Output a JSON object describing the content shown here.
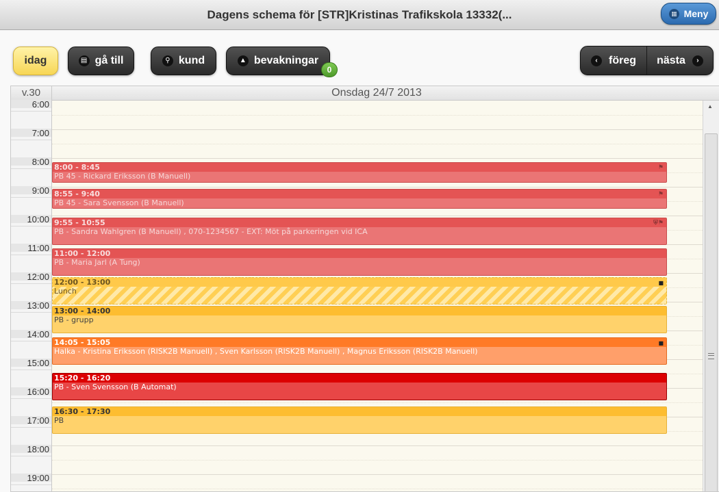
{
  "header": {
    "title": "Dagens schema för [STR]Kristinas Trafikskola 13332(...",
    "menu_label": "Meny"
  },
  "toolbar": {
    "today_label": "idag",
    "goto_label": "gå till",
    "customer_label": "kund",
    "watch_label": "bevakningar",
    "watch_count": "0",
    "prev_label": "föreg",
    "next_label": "nästa"
  },
  "calendar": {
    "week_label": "v.30",
    "day_title": "Onsdag 24/7 2013",
    "hours": [
      "6:00",
      "7:00",
      "8:00",
      "9:00",
      "10:00",
      "11:00",
      "12:00",
      "13:00",
      "14:00",
      "15:00",
      "16:00",
      "17:00",
      "18:00",
      "19:00"
    ],
    "events": [
      {
        "time": "8:00 - 8:45",
        "desc": "PB 45 - Rickard Eriksson (B Manuell)",
        "style": "red",
        "icon": "flag-icon"
      },
      {
        "time": "8:55 - 9:40",
        "desc": "PB 45 - Sara Svensson (B Manuell)",
        "style": "red",
        "icon": "flag-icon"
      },
      {
        "time": "9:55 - 10:55",
        "desc": "PB - Sandra Wahlgren (B Manuell) , 070-1234567 - EXT: Möt på parkeringen vid ICA",
        "style": "red",
        "icon": "shield-flag-icon"
      },
      {
        "time": "11:00 - 12:00",
        "desc": "PB - Maria Jarl (A Tung)",
        "style": "red",
        "icon": ""
      },
      {
        "time": "12:00 - 13:00",
        "desc": "Lunch",
        "style": "lunch",
        "icon": "lock-icon"
      },
      {
        "time": "13:00 - 14:00",
        "desc": "PB - grupp",
        "style": "amber",
        "icon": ""
      },
      {
        "time": "14:05 - 15:05",
        "desc": "Halka - Kristina Eriksson (RISK2B Manuell) , Sven Karlsson (RISK2B Manuell) , Magnus Eriksson (RISK2B Manuell)",
        "style": "orange",
        "icon": "lock-icon"
      },
      {
        "time": "15:20 - 16:20",
        "desc": "PB - Sven Svensson (B Automat)",
        "style": "dark",
        "icon": ""
      },
      {
        "time": "16:30 - 17:30",
        "desc": "PB",
        "style": "amber",
        "icon": ""
      }
    ]
  }
}
